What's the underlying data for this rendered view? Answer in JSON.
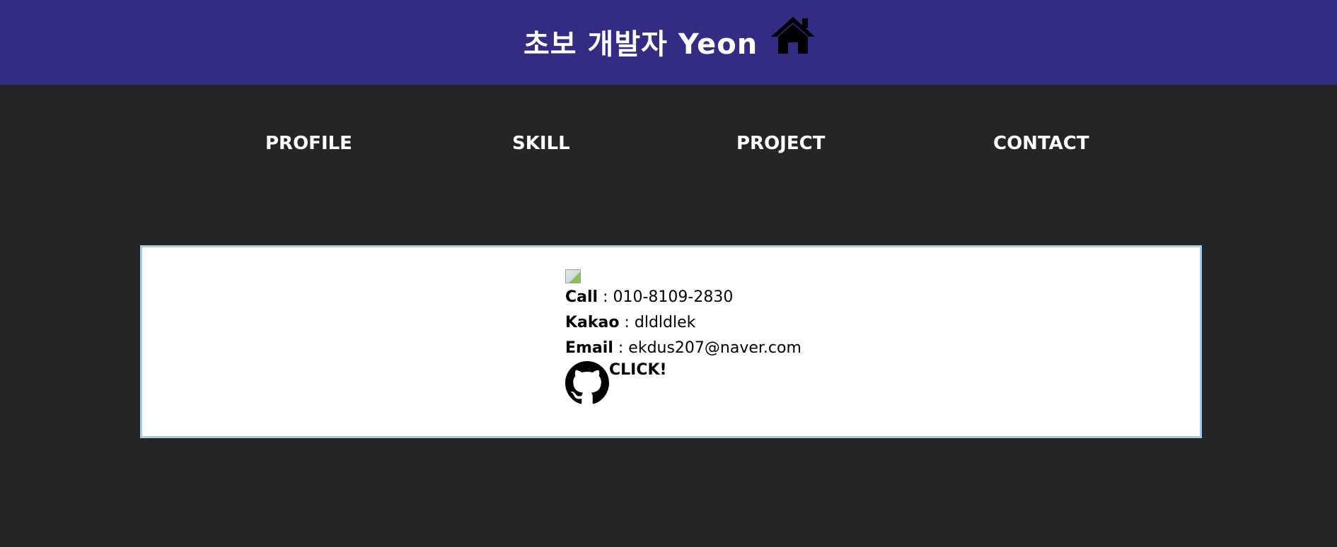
{
  "header": {
    "title": "초보 개발자 Yeon",
    "home_icon": "home-icon"
  },
  "nav": {
    "profile": "PROFILE",
    "skill": "SKILL",
    "project": "PROJECT",
    "contact": "CONTACT"
  },
  "contact": {
    "call_key": "Call",
    "call_value": " : 010-8109-2830",
    "kakao_key": "Kakao",
    "kakao_value": " : dldldlek",
    "email_key": "Email",
    "email_value": " : ekdus207@naver.com",
    "github_icon": "github-icon",
    "github_link": "CLICK!"
  },
  "colors": {
    "header_bg": "#322c83",
    "page_bg": "#252527",
    "box_border": "#a9cce3"
  }
}
